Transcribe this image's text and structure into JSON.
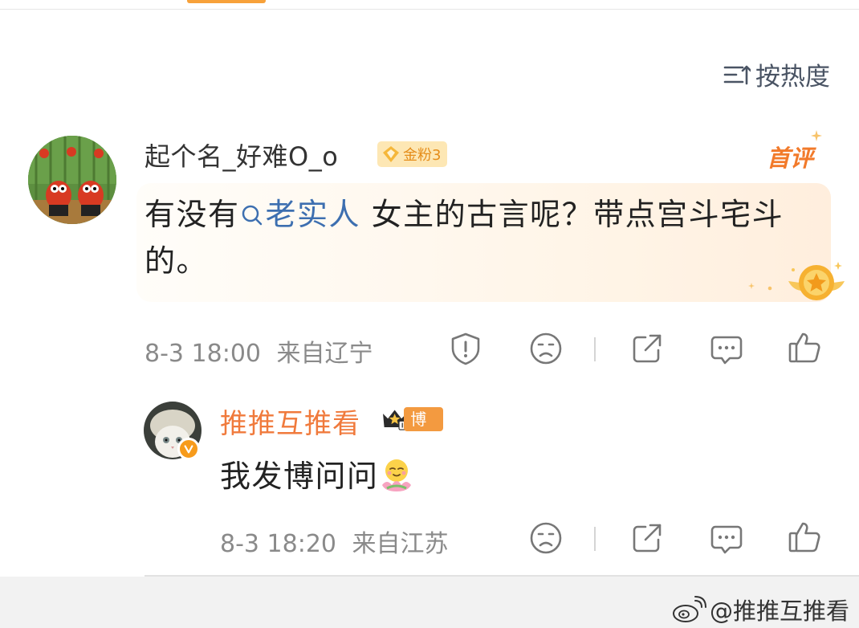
{
  "sort": {
    "label": "按热度",
    "icon": "sort-icon"
  },
  "comment": {
    "user_name": "起个名_好难O_o",
    "fan_badge": "金粉3",
    "first_tag": "首评",
    "text_before": "有没有",
    "topic": "老实人",
    "text_after": " 女主的古言呢？带点宫斗宅斗的。",
    "time": "8-3 18:00",
    "location": "来自辽宁",
    "actions": [
      "report-icon",
      "dislike-icon",
      "share-icon",
      "comment-icon",
      "like-icon"
    ]
  },
  "reply": {
    "user_name": "推推互推看",
    "role_badge": "博主",
    "rank_badge": "II",
    "text": "我发博问问",
    "time": "8-3 18:20",
    "location": "来自江苏",
    "actions": [
      "dislike-icon",
      "share-icon",
      "comment-icon",
      "like-icon"
    ]
  },
  "watermark": "@推推互推看",
  "colors": {
    "accent_orange": "#f07a3c",
    "topic_blue": "#3d6fb0",
    "meta_gray": "#8a8a8a"
  }
}
